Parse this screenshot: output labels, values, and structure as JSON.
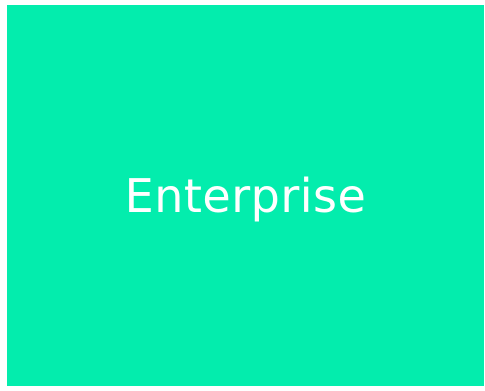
{
  "tile": {
    "label": "Enterprise",
    "background_color": "#03EDAD",
    "text_color": "#FFFFFF"
  }
}
